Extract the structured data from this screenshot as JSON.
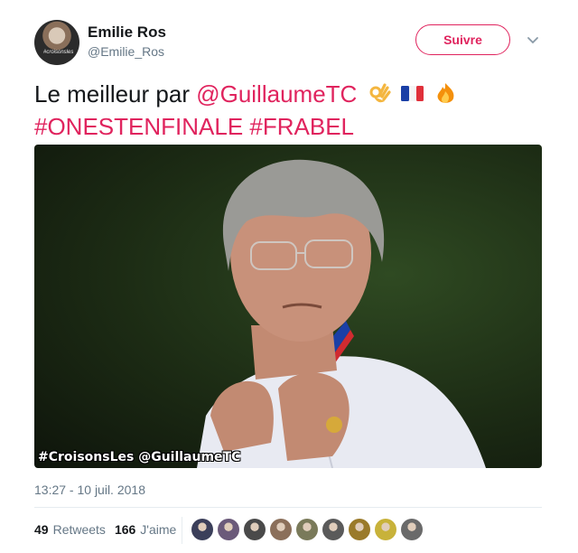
{
  "author": {
    "name": "Emilie Ros",
    "handle": "@Emilie_Ros",
    "avatar_caption": "#croisonsles"
  },
  "follow_label": "Suivre",
  "tweet": {
    "prefix": "Le meilleur par ",
    "mention": "@GuillaumeTC",
    "hashtag1": "#ONESTENFINALE",
    "hashtag2": "#FRABEL",
    "emojis": [
      "ok-hand-emoji",
      "french-flag-emoji",
      "fire-emoji"
    ]
  },
  "media": {
    "caption": "#CroisonsLes @GuillaumeTC"
  },
  "timestamp": "13:27 - 10 juil. 2018",
  "stats": {
    "retweets_count": "49",
    "retweets_label": "Retweets",
    "likes_count": "166",
    "likes_label": "J'aime"
  },
  "likers": [
    "#3b3f5a",
    "#6b5a7a",
    "#4a4a4a",
    "#8b6f5a",
    "#7a7a5a",
    "#5a5a5a",
    "#9a7a2a",
    "#c8b23a",
    "#6a6a6a"
  ],
  "colors": {
    "accent": "#e0245e",
    "muted": "#657786"
  }
}
